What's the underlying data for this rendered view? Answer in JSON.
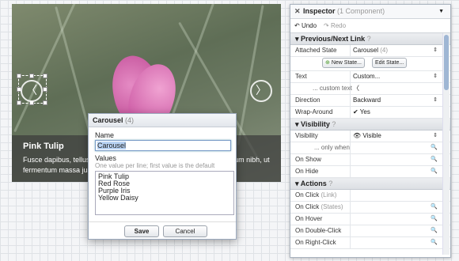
{
  "carousel": {
    "title": "Pink Tulip",
    "description": "Fusce dapibus, tellus ac cursus commodo, tortor mauris condimentum nibh, ut fermentum massa justo sit amet risus.",
    "prev_icon": "chevron-left-icon",
    "next_icon": "chevron-right-icon",
    "prev_glyph": "〈",
    "next_glyph": "〉"
  },
  "dialog": {
    "title": "Carousel",
    "count": "(4)",
    "name_label": "Name",
    "name_value": "Carousel",
    "values_label": "Values",
    "values_hint": "One value per line; first value is the default",
    "values": [
      "Pink Tulip",
      "Red Rose",
      "Purple Iris",
      "Yellow Daisy"
    ],
    "save_label": "Save",
    "cancel_label": "Cancel"
  },
  "inspector": {
    "title": "Inspector",
    "subtitle": "(1 Component)",
    "close_glyph": "✕",
    "menu_glyph": "▼",
    "undo_label": "Undo",
    "redo_label": "Redo",
    "sections": {
      "prevnext": "Previous/Next Link",
      "visibility": "Visibility",
      "actions": "Actions"
    },
    "help_glyph": "?",
    "attached_state_label": "Attached State",
    "attached_state_value": "Carousel",
    "attached_state_count": "(4)",
    "new_state_label": "New State...",
    "edit_state_label": "Edit State...",
    "text_label": "Text",
    "text_value": "Custom...",
    "custom_text_label": "... custom text",
    "custom_text_value": "〈",
    "direction_label": "Direction",
    "direction_value": "Backward",
    "wrap_label": "Wrap-Around",
    "wrap_value": "Yes",
    "visibility_label": "Visibility",
    "visibility_value": "Visible",
    "only_when_label": "... only when",
    "on_show_label": "On Show",
    "on_hide_label": "On Hide",
    "actions": [
      {
        "label": "On Click",
        "qualifier": "(Link)"
      },
      {
        "label": "On Click",
        "qualifier": "(States)"
      },
      {
        "label": "On Hover",
        "qualifier": ""
      },
      {
        "label": "On Double-Click",
        "qualifier": ""
      },
      {
        "label": "On Right-Click",
        "qualifier": ""
      }
    ]
  }
}
